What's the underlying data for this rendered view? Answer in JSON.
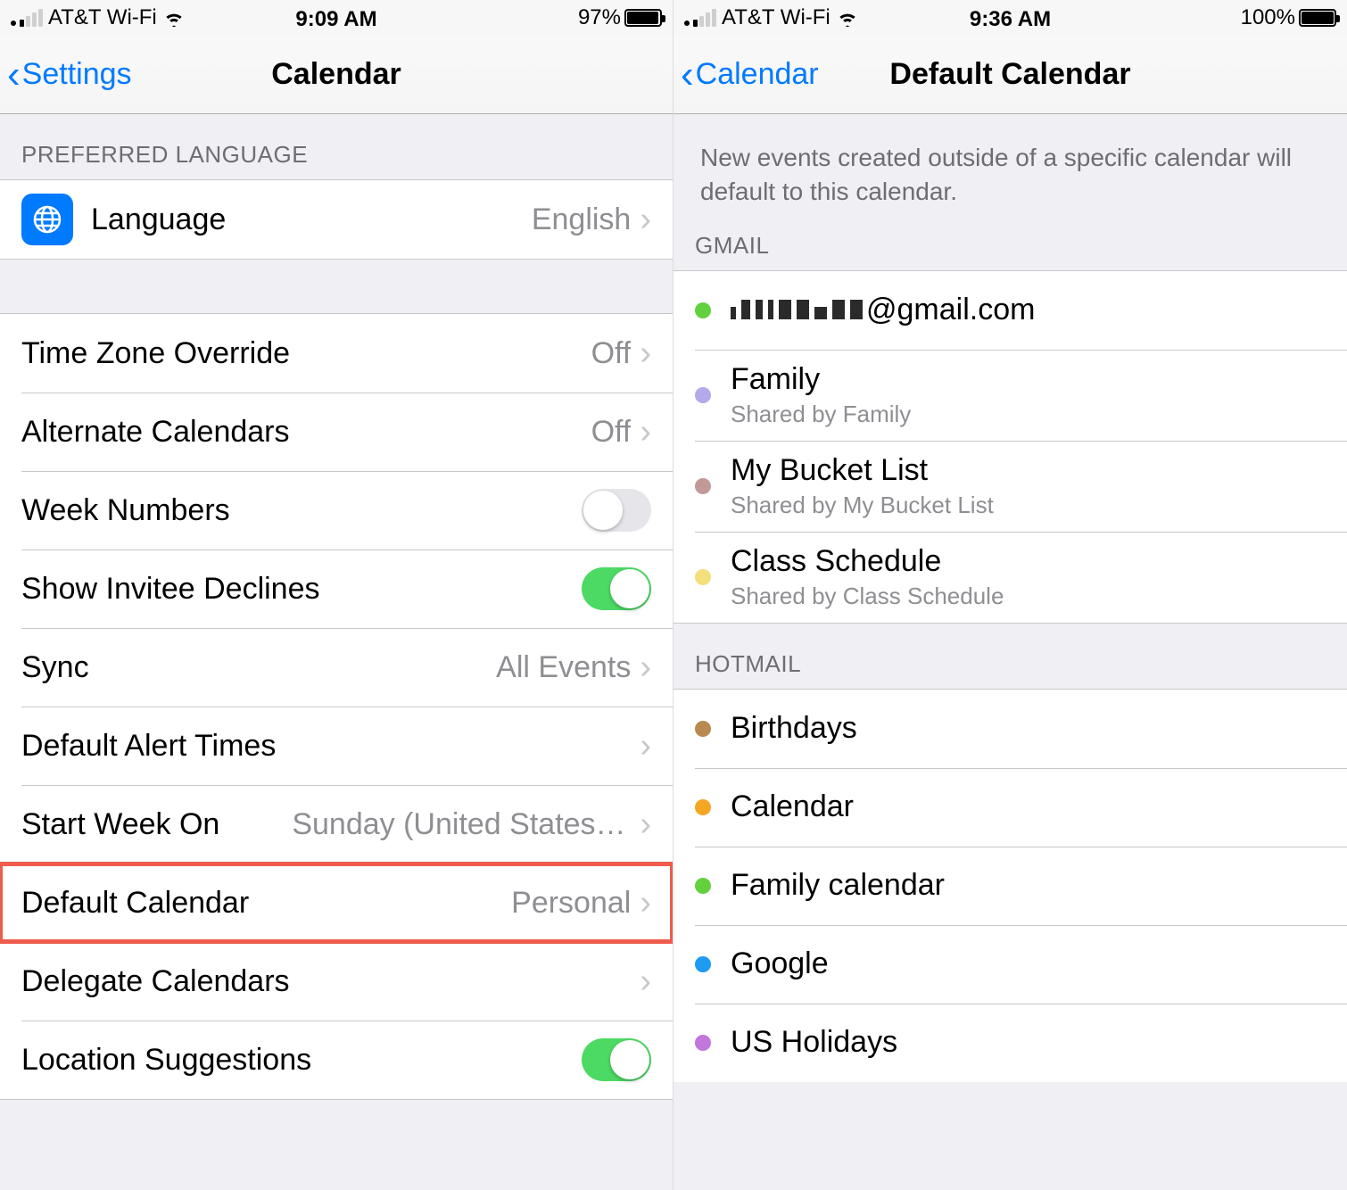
{
  "left": {
    "status": {
      "carrier": "AT&T Wi-Fi",
      "time": "9:09 AM",
      "battery_pct": "97%",
      "battery_fill": 97
    },
    "nav": {
      "back": "Settings",
      "title": "Calendar"
    },
    "section_language_header": "PREFERRED LANGUAGE",
    "language_row": {
      "label": "Language",
      "value": "English"
    },
    "rows": {
      "tz": {
        "label": "Time Zone Override",
        "value": "Off"
      },
      "alt": {
        "label": "Alternate Calendars",
        "value": "Off"
      },
      "wknum": {
        "label": "Week Numbers",
        "on": false
      },
      "decl": {
        "label": "Show Invitee Declines",
        "on": true
      },
      "sync": {
        "label": "Sync",
        "value": "All Events"
      },
      "alert": {
        "label": "Default Alert Times"
      },
      "start": {
        "label": "Start Week On",
        "value": "Sunday (United States d…"
      },
      "defcal": {
        "label": "Default Calendar",
        "value": "Personal"
      },
      "deleg": {
        "label": "Delegate Calendars"
      },
      "loc": {
        "label": "Location Suggestions",
        "on": true
      }
    }
  },
  "right": {
    "status": {
      "carrier": "AT&T Wi-Fi",
      "time": "9:36 AM",
      "battery_pct": "100%",
      "battery_fill": 100
    },
    "nav": {
      "back": "Calendar",
      "title": "Default Calendar"
    },
    "description": "New events created outside of a specific calendar will default to this calendar.",
    "gmail_header": "GMAIL",
    "gmail": [
      {
        "title_suffix": "@gmail.com",
        "redacted": true,
        "color": "#63d13e"
      },
      {
        "title": "Family",
        "sub": "Shared by Family",
        "color": "#b4a9ea"
      },
      {
        "title": "My Bucket List",
        "sub": "Shared by My Bucket List",
        "color": "#c19a97"
      },
      {
        "title": "Class Schedule",
        "sub": "Shared by Class Schedule",
        "color": "#f3e07a"
      }
    ],
    "hotmail_header": "HOTMAIL",
    "hotmail": [
      {
        "title": "Birthdays",
        "color": "#b88a4f"
      },
      {
        "title": "Calendar",
        "color": "#f5a623"
      },
      {
        "title": "Family calendar",
        "color": "#63d13e"
      },
      {
        "title": "Google",
        "color": "#1d9af1"
      },
      {
        "title": "US Holidays",
        "color": "#c177dc"
      }
    ]
  }
}
